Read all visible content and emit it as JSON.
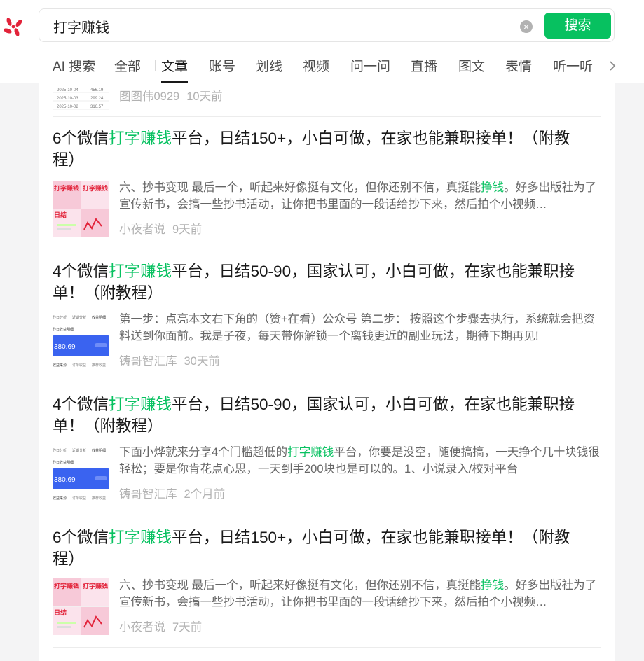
{
  "search": {
    "query": "打字赚钱",
    "button": "搜索"
  },
  "tabs": [
    "AI 搜索",
    "全部",
    "文章",
    "账号",
    "划线",
    "视频",
    "问一问",
    "直播",
    "图文",
    "表情",
    "听一听"
  ],
  "colors": {
    "accent": "#07c160",
    "text": "#191919",
    "muted": "#b2b2b2"
  },
  "partial_card": {
    "author": "图图伟0929",
    "time": "10天前",
    "thumb_rows": [
      [
        "2025-10-04",
        "456.19"
      ],
      [
        "2025-10-03",
        "299.24"
      ],
      [
        "2025-10-02",
        "316.57"
      ]
    ]
  },
  "cards": [
    {
      "title": [
        "6个微信",
        "打字赚钱",
        "平台，日结150+，小白可做，在家也能兼职接单！（附教程）"
      ],
      "desc": [
        "六、抄书变现 最后一个，听起来好像挺有文化，但你还别不信，真挺能",
        "挣钱",
        "。好多出版社为了宣传新书，会搞一些抄书活动，让你把书里面的一段话给抄下来，然后拍个小视频…"
      ],
      "author": "小夜者说",
      "time": "9天前"
    },
    {
      "title": [
        "4个微信",
        "打字赚钱",
        "平台，日结50-90，国家认可，小白可做，在家也能兼职接单！（附教程）"
      ],
      "desc": [
        "第一步：点亮本文右下角的（赞+在看）公众号 第二步： 按照这个步骤去执行，系统就会把资料送到你面前。我是子夜，每天带你解锁一个离钱更近的副业玩法，期待下期再见!",
        "",
        ""
      ],
      "author": "铸哥智汇库",
      "time": "30天前"
    },
    {
      "title": [
        "4个微信",
        "打字赚钱",
        "平台，日结50-90，国家认可，小白可做，在家也能兼职接单！（附教程）"
      ],
      "desc": [
        "下面小烨就来分享4个门槛超低的",
        "打字赚钱",
        "平台，你要是没空，随便搞搞，一天挣个几十块钱很轻松；要是你肯花点心思，一天到手200块也是可以的。1、小说录入/校对平台"
      ],
      "author": "铸哥智汇库",
      "time": "2个月前"
    },
    {
      "title": [
        "6个微信",
        "打字赚钱",
        "平台，日结150+，小白可做，在家也能兼职接单！（附教程）"
      ],
      "desc": [
        "六、抄书变现 最后一个，听起来好像挺有文化，但你还别不信，真挺能",
        "挣钱",
        "。好多出版社为了宣传新书，会搞一些抄书活动，让你把书里面的一段话给抄下来，然后拍个小视频…"
      ],
      "author": "小夜者说",
      "time": "7天前"
    }
  ],
  "thumbs": {
    "pink": {
      "line1": "打字赚钱",
      "line2": "日结"
    },
    "blue": {
      "tabs": [
        "昨日分析",
        "近期分析",
        "收益明细"
      ],
      "label": "昨日收益明细",
      "amount": "380.69",
      "footer": [
        "收益来源",
        "订单收益",
        "推荐收益"
      ]
    }
  }
}
